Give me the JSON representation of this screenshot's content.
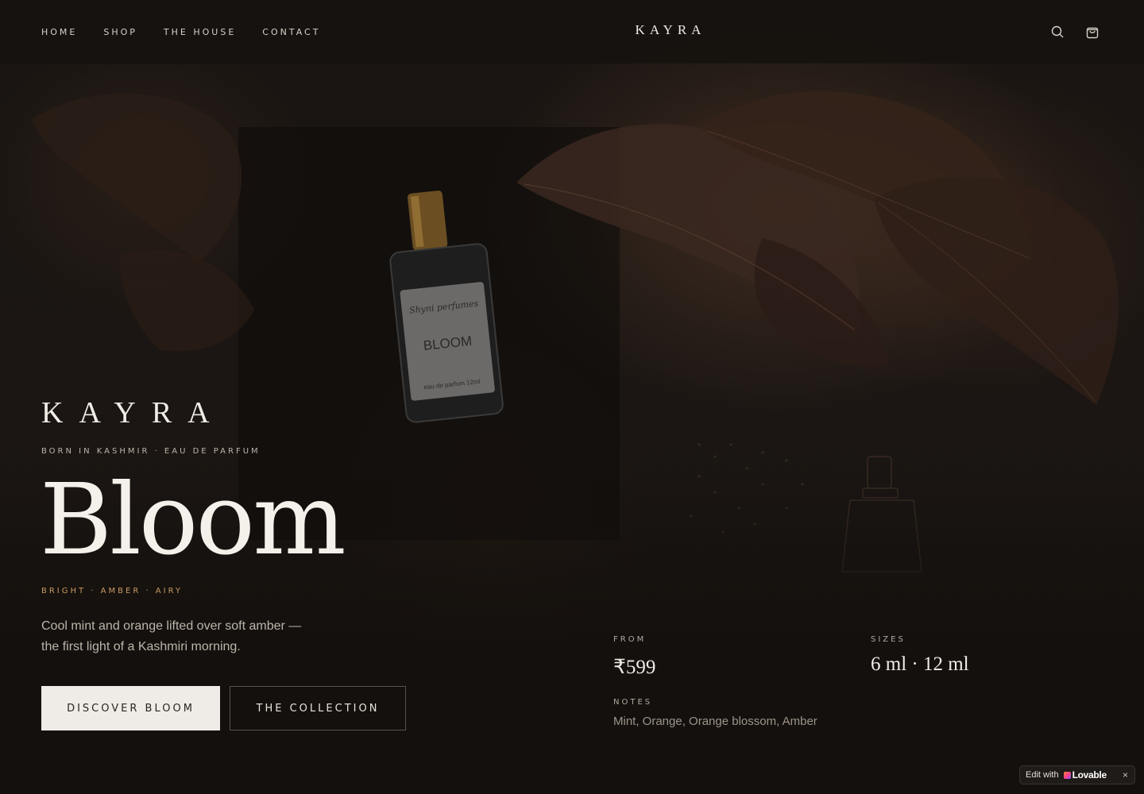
{
  "header": {
    "nav": [
      "HOME",
      "SHOP",
      "THE HOUSE",
      "CONTACT"
    ],
    "logo": "KAYRA",
    "icons": [
      "search-icon",
      "shopping-bag-icon"
    ]
  },
  "hero": {
    "wordmark": "KAYRA",
    "tagline": "BORN IN KASHMIR · EAU DE PARFUM",
    "title": "Bloom",
    "accords": "BRIGHT · AMBER · AIRY",
    "description": "Cool mint and orange lifted over soft amber — the first light of a Kashmiri morning.",
    "primary_cta": "DISCOVER BLOOM",
    "secondary_cta": "THE COLLECTION"
  },
  "bottle_label": {
    "script": "Shyni perfumes",
    "name": "BLOOM",
    "sub": "eau de parfum 12ml"
  },
  "details": {
    "from_label": "FROM",
    "price": "₹599",
    "sizes_label": "SIZES",
    "sizes": "6 ml · 12 ml",
    "notes_label": "NOTES",
    "notes": "Mint, Orange, Orange blossom, Amber"
  },
  "badge": {
    "edit_text": "Edit with",
    "brand": "Lovable",
    "close": "×"
  },
  "colors": {
    "background": "#14100d",
    "accent": "#c99a63",
    "primary_button": "#efebe6"
  }
}
